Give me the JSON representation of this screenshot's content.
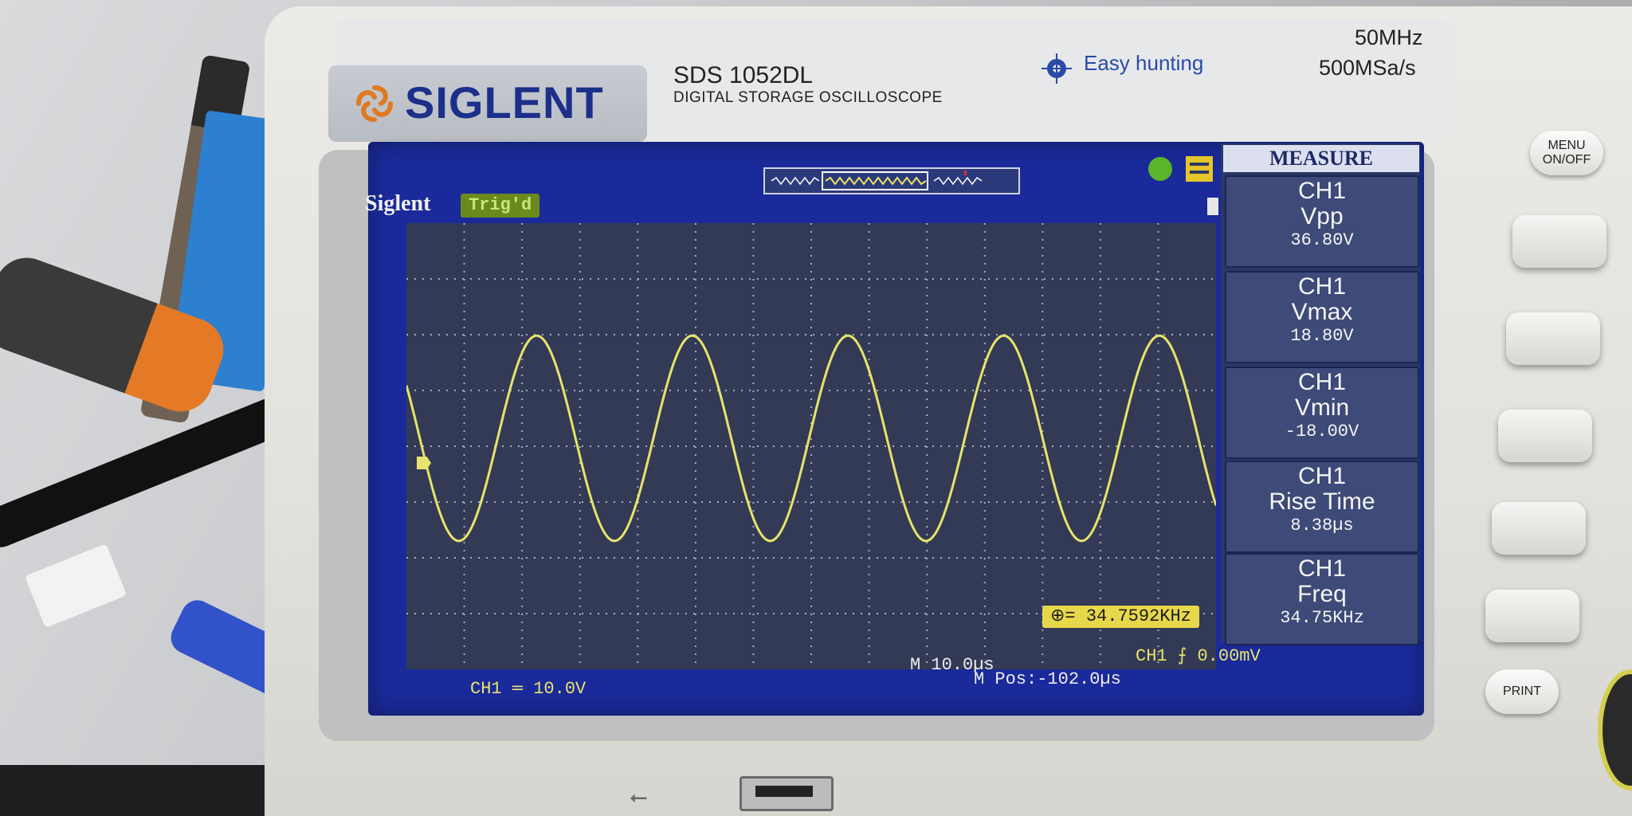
{
  "device": {
    "brand": "SIGLENT",
    "model": "SDS 1052DL",
    "model_desc": "DIGITAL STORAGE OSCILLOSCOPE",
    "feature": "Easy hunting",
    "bandwidth": "50MHz",
    "sample_rate": "500MSa/s"
  },
  "screen": {
    "brand_label": "Siglent",
    "trigger_status": "Trig'd",
    "measure_title": "MEASURE",
    "measurements": [
      {
        "channel": "CH1",
        "name": "Vpp",
        "value": "36.80V"
      },
      {
        "channel": "CH1",
        "name": "Vmax",
        "value": "18.80V"
      },
      {
        "channel": "CH1",
        "name": "Vmin",
        "value": "-18.00V"
      },
      {
        "channel": "CH1",
        "name": "Rise Time",
        "value": "8.38µs"
      },
      {
        "channel": "CH1",
        "name": "Freq",
        "value": "34.75KHz"
      }
    ],
    "freq_counter": "⊕= 34.7592KHz",
    "ch1_scale": "CH1 ═ 10.0V",
    "timebase": "M 10.0µs",
    "position": "M Pos:-102.0µs",
    "trigger_level": "CH1 ⨍ 0.00mV"
  },
  "buttons": {
    "menu": "MENU\nON/OFF",
    "print": "PRINT"
  },
  "colors": {
    "trace": "#e8e36a",
    "screen_bg": "#323a56",
    "brand_blue": "#1c2f8a"
  },
  "waveform": {
    "cycles_visible": 5.2,
    "amplitude_v": 18.4,
    "volts_per_div": 10.0
  }
}
